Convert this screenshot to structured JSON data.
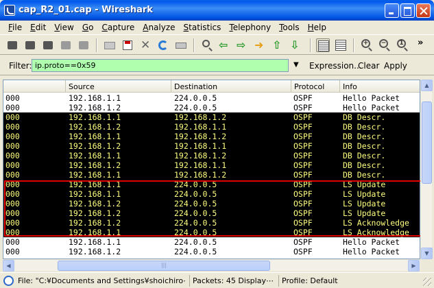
{
  "window": {
    "title": "cap_R2_01.cap - Wireshark"
  },
  "menu": [
    "File",
    "Edit",
    "View",
    "Go",
    "Capture",
    "Analyze",
    "Statistics",
    "Telephony",
    "Tools",
    "Help"
  ],
  "menu_underline": [
    "F",
    "E",
    "V",
    "G",
    "C",
    "A",
    "S",
    "T",
    "T",
    "H"
  ],
  "toolbar": {
    "more": "»"
  },
  "filter": {
    "label": "Filter:",
    "value": "ip.proto==0x59",
    "expression": "Expression...",
    "clear": "Clear",
    "apply": "Apply"
  },
  "columns": [
    "",
    "Source",
    "Destination",
    "Protocol",
    "Info"
  ],
  "rows": [
    {
      "no": "000",
      "src": "192.168.1.1",
      "dst": "224.0.0.5",
      "proto": "OSPF",
      "info": "Hello Packet",
      "style": "light"
    },
    {
      "no": "000",
      "src": "192.168.1.2",
      "dst": "224.0.0.5",
      "proto": "OSPF",
      "info": "Hello Packet",
      "style": "light"
    },
    {
      "no": "000",
      "src": "192.168.1.1",
      "dst": "192.168.1.2",
      "proto": "OSPF",
      "info": "DB Descr.",
      "style": "dark"
    },
    {
      "no": "000",
      "src": "192.168.1.2",
      "dst": "192.168.1.1",
      "proto": "OSPF",
      "info": "DB Descr.",
      "style": "dark"
    },
    {
      "no": "000",
      "src": "192.168.1.1",
      "dst": "192.168.1.2",
      "proto": "OSPF",
      "info": "DB Descr.",
      "style": "dark"
    },
    {
      "no": "000",
      "src": "192.168.1.2",
      "dst": "192.168.1.1",
      "proto": "OSPF",
      "info": "DB Descr.",
      "style": "dark"
    },
    {
      "no": "000",
      "src": "192.168.1.1",
      "dst": "192.168.1.2",
      "proto": "OSPF",
      "info": "DB Descr.",
      "style": "dark"
    },
    {
      "no": "000",
      "src": "192.168.1.2",
      "dst": "192.168.1.1",
      "proto": "OSPF",
      "info": "DB Descr.",
      "style": "dark"
    },
    {
      "no": "000",
      "src": "192.168.1.1",
      "dst": "192.168.1.2",
      "proto": "OSPF",
      "info": "DB Descr.",
      "style": "dark"
    },
    {
      "no": "000",
      "src": "192.168.1.1",
      "dst": "224.0.0.5",
      "proto": "OSPF",
      "info": "LS Update",
      "style": "dark"
    },
    {
      "no": "000",
      "src": "192.168.1.1",
      "dst": "224.0.0.5",
      "proto": "OSPF",
      "info": "LS Update",
      "style": "dark"
    },
    {
      "no": "000",
      "src": "192.168.1.2",
      "dst": "224.0.0.5",
      "proto": "OSPF",
      "info": "LS Update",
      "style": "dark"
    },
    {
      "no": "000",
      "src": "192.168.1.2",
      "dst": "224.0.0.5",
      "proto": "OSPF",
      "info": "LS Update",
      "style": "dark"
    },
    {
      "no": "000",
      "src": "192.168.1.2",
      "dst": "224.0.0.5",
      "proto": "OSPF",
      "info": "LS Acknowledge",
      "style": "dark"
    },
    {
      "no": "000",
      "src": "192.168.1.1",
      "dst": "224.0.0.5",
      "proto": "OSPF",
      "info": "LS Acknowledge",
      "style": "dark"
    },
    {
      "no": "000",
      "src": "192.168.1.1",
      "dst": "224.0.0.5",
      "proto": "OSPF",
      "info": "Hello Packet",
      "style": "light"
    },
    {
      "no": "000",
      "src": "192.168.1.2",
      "dst": "224.0.0.5",
      "proto": "OSPF",
      "info": "Hello Packet",
      "style": "light"
    }
  ],
  "status": {
    "file": "File: \"C:¥Documents and Settings¥shoichiro⋯",
    "packets": "Packets: 45 Display⋯",
    "profile": "Profile: Default"
  },
  "colors": {
    "dark_row_bg": "#000000",
    "dark_row_fg": "#FFFF80",
    "filter_bg": "#AFFFAF",
    "highlight": "#E00000"
  }
}
